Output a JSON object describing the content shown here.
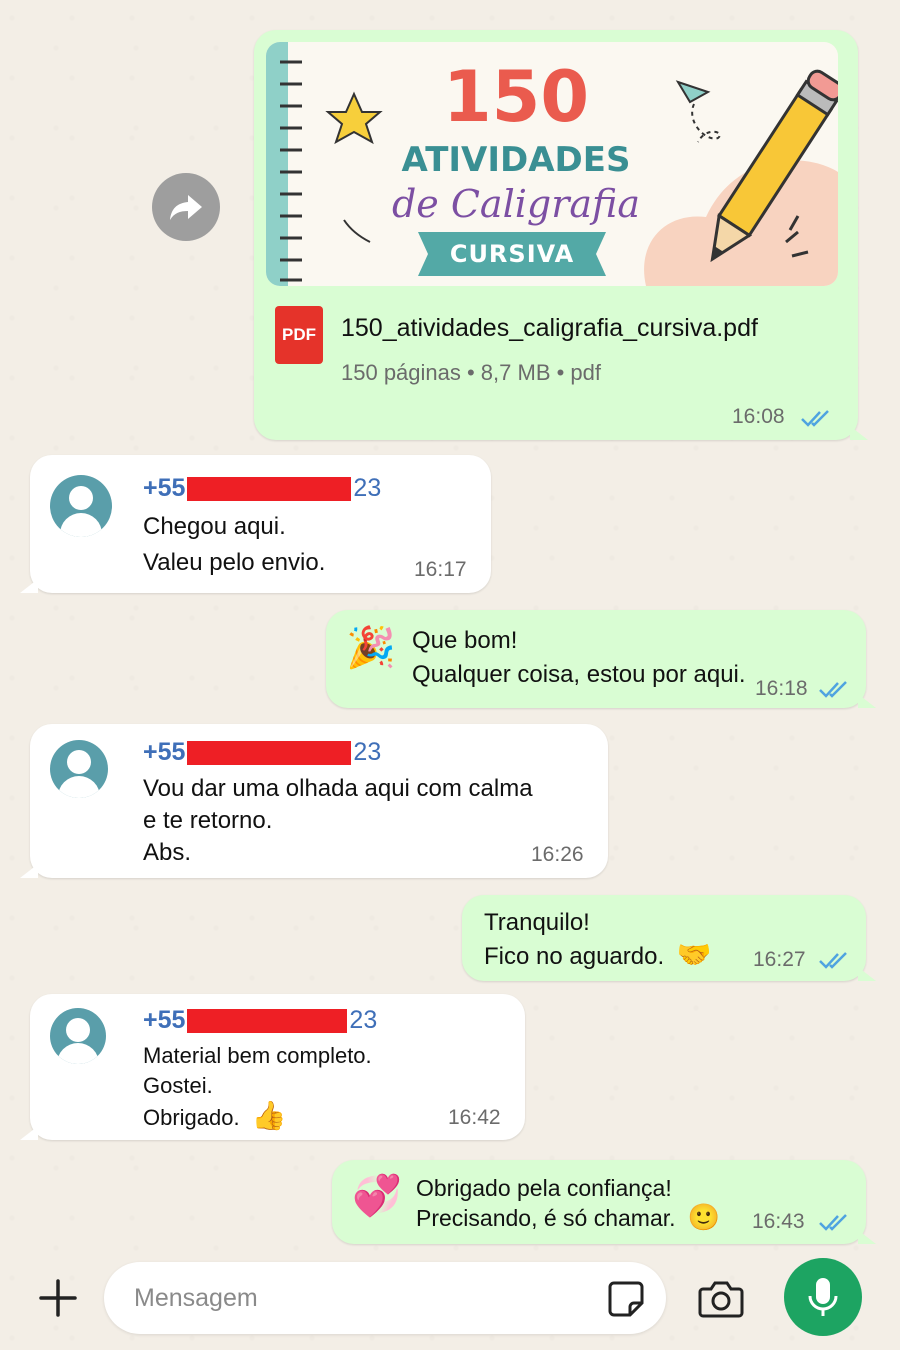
{
  "colors": {
    "outgoing_bubble": "#d9fdd3",
    "incoming_bubble": "#ffffff",
    "sender_name": "#3f6fb8",
    "read_ticks": "#4fa3e0",
    "mic_button": "#1da462",
    "redaction": "#ee1f25"
  },
  "document": {
    "cover": {
      "number": "150",
      "line1": "ATIVIDADES",
      "line2": "de Caligrafia",
      "ribbon": "CURSIVA"
    },
    "icon_label": "PDF",
    "filename": "150_atividades_caligrafia_cursiva.pdf",
    "meta": "150 páginas • 8,7 MB • pdf",
    "time": "16:08",
    "status_icon": "double-check-read-icon"
  },
  "messages": [
    {
      "direction": "in",
      "sender_prefix": "+55",
      "sender_suffix": "23",
      "lines": [
        "Chegou aqui.",
        "Valeu pelo envio."
      ],
      "time": "16:17"
    },
    {
      "direction": "out",
      "emoji": "🎉",
      "lines": [
        "Que bom!",
        "Qualquer coisa, estou por aqui."
      ],
      "time": "16:18"
    },
    {
      "direction": "in",
      "sender_prefix": "+55",
      "sender_suffix": "23",
      "lines": [
        "Vou dar uma olhada aqui com calma",
        "e te retorno.",
        "Abs."
      ],
      "time": "16:26"
    },
    {
      "direction": "out",
      "lines": [
        "Tranquilo!",
        "Fico no aguardo."
      ],
      "trailing_emoji": "🤝",
      "time": "16:27"
    },
    {
      "direction": "in",
      "sender_prefix": "+55",
      "sender_suffix": "23",
      "lines": [
        "Material bem completo.",
        "Gostei.",
        "Obrigado."
      ],
      "trailing_emoji": "👍",
      "time": "16:42"
    },
    {
      "direction": "out",
      "emoji": "💞",
      "lines": [
        "Obrigado pela confiança!",
        "Precisando, é só chamar."
      ],
      "trailing_emoji": "🙂",
      "time": "16:43"
    }
  ],
  "composer": {
    "placeholder": "Mensagem",
    "icons": [
      "plus-icon",
      "sticker-icon",
      "camera-icon",
      "microphone-icon"
    ]
  }
}
